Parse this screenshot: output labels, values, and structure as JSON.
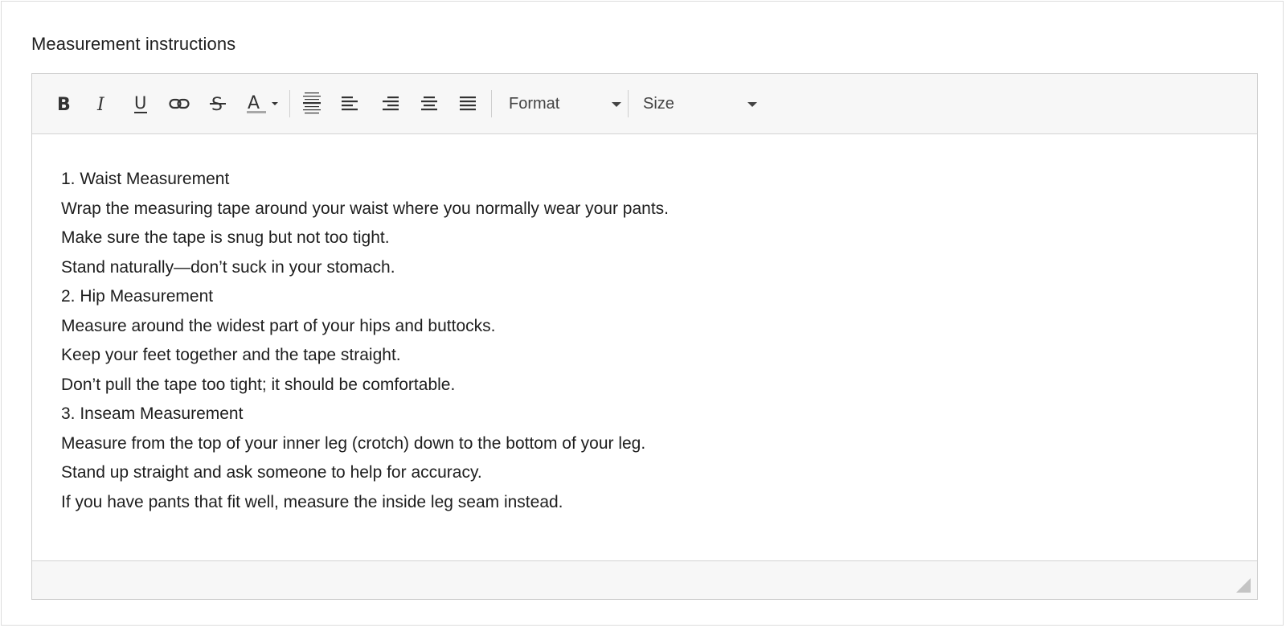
{
  "field": {
    "label": "Measurement instructions"
  },
  "toolbar": {
    "buttons": [
      {
        "name": "bold",
        "icon": "bold-icon"
      },
      {
        "name": "italic",
        "icon": "italic-icon"
      },
      {
        "name": "underline",
        "icon": "underline-icon"
      },
      {
        "name": "link",
        "icon": "link-icon"
      },
      {
        "name": "strikethrough",
        "icon": "strikethrough-icon"
      },
      {
        "name": "text-color",
        "icon": "text-color-icon"
      },
      {
        "name": "align-justify-center",
        "icon": "align-center-justify-icon"
      },
      {
        "name": "align-left",
        "icon": "align-left-icon"
      },
      {
        "name": "align-right",
        "icon": "align-right-icon"
      },
      {
        "name": "align-center",
        "icon": "align-center-icon"
      },
      {
        "name": "align-justify",
        "icon": "align-justify-icon"
      }
    ],
    "format_label": "Format",
    "size_label": "Size"
  },
  "content": {
    "lines": [
      "1. Waist Measurement",
      "Wrap the measuring tape around your waist where you normally wear your pants.",
      "Make sure the tape is snug but not too tight.",
      "Stand naturally—don’t suck in your stomach.",
      "2. Hip Measurement",
      "Measure around the widest part of your hips and buttocks.",
      "Keep your feet together and the tape straight.",
      "Don’t pull the tape too tight; it should be comfortable.",
      "3. Inseam Measurement",
      "Measure from the top of your inner leg (crotch) down to the bottom of your leg.",
      "Stand up straight and ask someone to help for accuracy.",
      "If you have pants that fit well, measure the inside leg seam instead."
    ]
  },
  "colors": {
    "toolbar_bg": "#f7f7f7",
    "border": "#cfcfcf",
    "text": "#1e1e1e",
    "icon": "#333333"
  }
}
